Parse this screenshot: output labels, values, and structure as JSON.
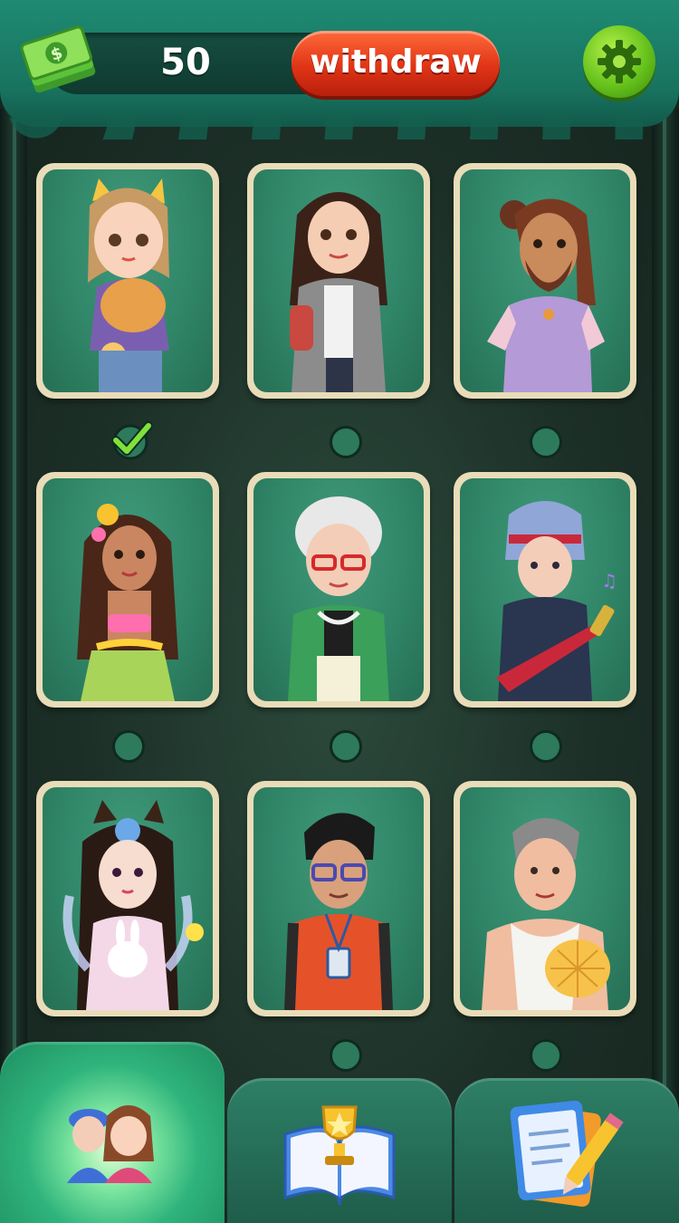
{
  "header": {
    "balance": "50",
    "withdraw_label": "withdraw"
  },
  "characters": [
    {
      "name": "cat-girl",
      "selected": true
    },
    {
      "name": "office-woman",
      "selected": false
    },
    {
      "name": "bearded-man",
      "selected": false
    },
    {
      "name": "hula-girl",
      "selected": false
    },
    {
      "name": "grandma",
      "selected": false
    },
    {
      "name": "rocker",
      "selected": false
    },
    {
      "name": "bunny-princess",
      "selected": false
    },
    {
      "name": "student-boy",
      "selected": false
    },
    {
      "name": "old-man-fan",
      "selected": false
    }
  ],
  "nav": {
    "tabs": [
      {
        "name": "characters",
        "icon": "people-icon",
        "active": true
      },
      {
        "name": "achievements",
        "icon": "trophy-book-icon",
        "active": false
      },
      {
        "name": "tasks",
        "icon": "notepad-pencil-icon",
        "active": false
      }
    ]
  },
  "colors": {
    "accent_green": "#2f8466",
    "withdraw_red": "#e03416",
    "settings_green": "#66c21c",
    "card_border": "#e9dcb8"
  }
}
